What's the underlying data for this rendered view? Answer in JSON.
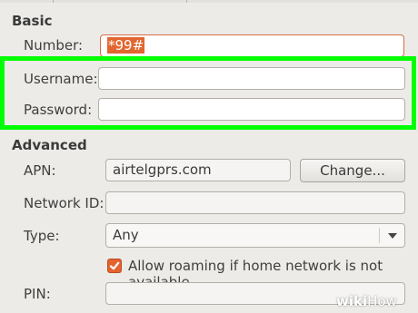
{
  "basic": {
    "section_title": "Basic",
    "number_label": "Number:",
    "number_value": "*99#",
    "username_label": "Username:",
    "username_value": "",
    "password_label": "Password:",
    "password_value": ""
  },
  "advanced": {
    "section_title": "Advanced",
    "apn_label": "APN:",
    "apn_value": "airtelgprs.com",
    "change_button": "Change...",
    "network_id_label": "Network ID:",
    "network_id_value": "",
    "type_label": "Type:",
    "type_value": "Any",
    "roaming_label": "Allow roaming if home network is not available",
    "roaming_checked": true,
    "pin_label": "PIN:",
    "pin_value": ""
  },
  "colors": {
    "highlight": "#00ff00",
    "accent": "#e5622f",
    "background": "#ecebe8"
  },
  "watermark": {
    "bold": "wiki",
    "light": "How"
  }
}
